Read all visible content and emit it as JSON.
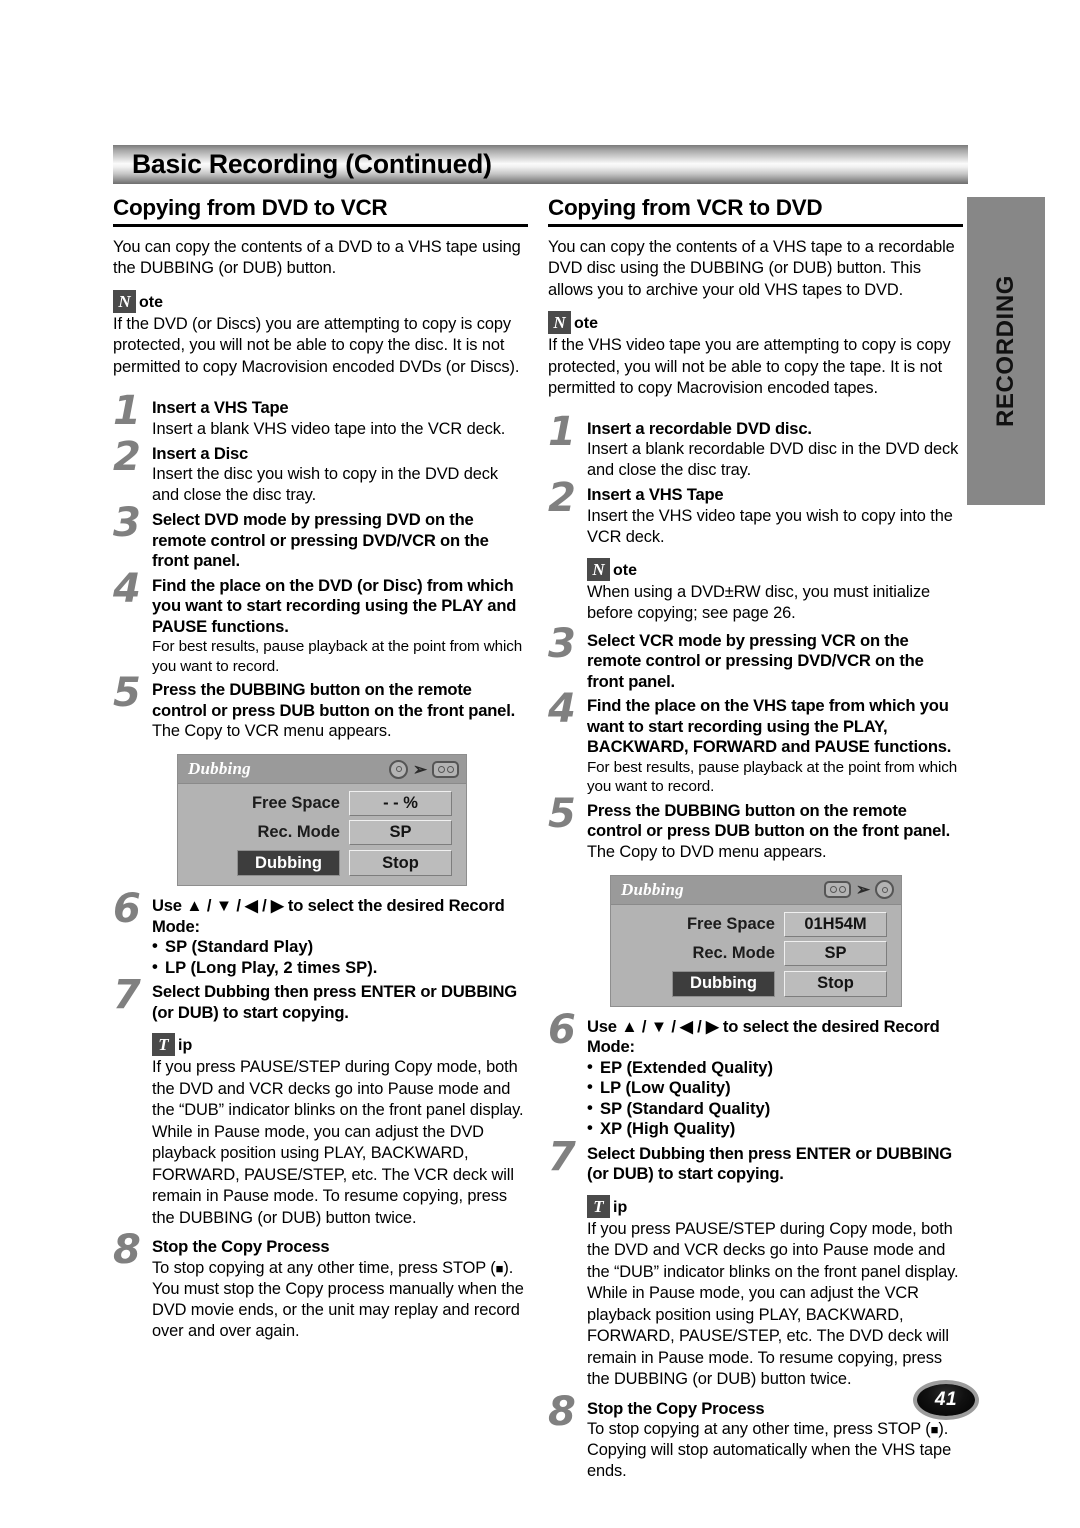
{
  "header": {
    "title": "Basic Recording (Continued)"
  },
  "side_tab": {
    "label": "RECORDING"
  },
  "page_number": "41",
  "left_column": {
    "section_title": "Copying from DVD to VCR",
    "intro": "You can copy the contents of a DVD to a VHS tape using the DUBBING (or DUB) button.",
    "note": {
      "glyph": "N",
      "tail": "ote",
      "text": "If the DVD (or Discs) you are attempting to copy is copy protected, you will not be able to copy the disc. It is not permitted to copy Macrovision encoded DVDs (or Discs)."
    },
    "steps": [
      {
        "num": "1",
        "head": "Insert a VHS Tape",
        "sub": "Insert a blank VHS video tape into the VCR deck."
      },
      {
        "num": "2",
        "head": "Insert a Disc",
        "sub": "Insert the disc you wish to copy in the DVD deck and close the disc tray."
      },
      {
        "num": "3",
        "head": "Select DVD mode by pressing DVD on the remote control or pressing DVD/VCR on the front panel."
      },
      {
        "num": "4",
        "head": "Find the place on the DVD (or Disc) from which you want to start recording using the PLAY and PAUSE functions.",
        "sub": "For best results, pause playback at the point from which you want to record."
      },
      {
        "num": "5",
        "head": "Press the DUBBING button on the remote control or press DUB button on the front panel.",
        "sub": "The Copy to VCR menu appears."
      },
      {
        "num": "6",
        "head": "Use ▲ / ▼ / ◀ / ▶ to select the desired Record Mode:",
        "bullets": [
          "SP (Standard Play)",
          "LP (Long Play, 2 times SP)."
        ]
      },
      {
        "num": "7",
        "head": "Select Dubbing then press ENTER or DUBBING (or DUB) to start copying."
      },
      {
        "num": "8",
        "head": "Stop the Copy Process",
        "sub_pre": "To stop copying at any other time, press STOP (",
        "sub_post": "). You must stop the Copy process manually when the DVD movie ends, or the unit may replay and record over and over again."
      }
    ],
    "osd": {
      "title": "Dubbing",
      "source_icon": "disc-icon",
      "arrow_icon": "arrow-right-icon",
      "target_icon": "cassette-icon",
      "free_space_label": "Free Space",
      "free_space_value": "- - %",
      "rec_mode_label": "Rec. Mode",
      "rec_mode_value": "SP",
      "dubbing_button": "Dubbing",
      "stop_button": "Stop"
    },
    "tip": {
      "glyph": "T",
      "tail": "ip",
      "text": "If you press PAUSE/STEP during Copy mode, both the DVD and VCR decks go into Pause mode and the “DUB” indicator blinks on the front panel display. While in Pause mode, you can adjust the DVD playback position using PLAY, BACKWARD, FORWARD, PAUSE/STEP, etc. The VCR deck will remain in Pause mode. To resume copying, press the DUBBING (or DUB) button twice."
    }
  },
  "right_column": {
    "section_title": "Copying from VCR to DVD",
    "intro": "You can copy the contents of a VHS tape to a recordable DVD disc using the DUBBING (or DUB) button. This allows you to archive your old VHS tapes to DVD.",
    "note": {
      "glyph": "N",
      "tail": "ote",
      "text": "If the VHS video tape you are attempting to copy is copy protected, you will not be able to copy the tape. It is not permitted to copy Macrovision encoded tapes."
    },
    "note2": {
      "glyph": "N",
      "tail": "ote",
      "text": "When using a DVD±RW disc, you must initialize before copying; see page 26."
    },
    "steps": [
      {
        "num": "1",
        "head": "Insert a recordable DVD disc.",
        "sub": "Insert a blank recordable DVD disc in the DVD deck and close the disc tray."
      },
      {
        "num": "2",
        "head": "Insert a VHS Tape",
        "sub": "Insert the VHS video tape you wish to copy into the VCR deck."
      },
      {
        "num": "3",
        "head": "Select VCR mode by pressing VCR on the remote control or pressing DVD/VCR on the front panel."
      },
      {
        "num": "4",
        "head": "Find the place on the VHS tape from which you want to start recording using the PLAY, BACKWARD, FORWARD and PAUSE functions.",
        "sub": "For best results, pause playback at the point from which you want to record."
      },
      {
        "num": "5",
        "head": "Press the DUBBING button on the remote control or press DUB button on the front panel.",
        "sub": "The Copy to DVD menu appears."
      },
      {
        "num": "6",
        "head": "Use ▲ / ▼ / ◀ / ▶ to select the desired Record Mode:",
        "bullets": [
          "EP (Extended Quality)",
          "LP (Low Quality)",
          "SP (Standard Quality)",
          "XP (High Quality)"
        ]
      },
      {
        "num": "7",
        "head": "Select Dubbing then press ENTER or DUBBING (or DUB) to start copying."
      },
      {
        "num": "8",
        "head": "Stop the Copy Process",
        "sub_pre": "To stop copying at any other time, press STOP (",
        "sub_post": "). Copying will stop automatically when the VHS tape ends."
      }
    ],
    "osd": {
      "title": "Dubbing",
      "source_icon": "cassette-icon",
      "arrow_icon": "arrow-right-icon",
      "target_icon": "disc-icon",
      "free_space_label": "Free Space",
      "free_space_value": "01H54M",
      "rec_mode_label": "Rec. Mode",
      "rec_mode_value": "SP",
      "dubbing_button": "Dubbing",
      "stop_button": "Stop"
    },
    "tip": {
      "glyph": "T",
      "tail": "ip",
      "text": "If you press PAUSE/STEP during Copy mode, both the DVD and VCR decks go into Pause mode and the “DUB” indicator blinks on the front panel display. While in Pause mode, you can adjust the VCR playback position using PLAY, BACKWARD, FORWARD, PAUSE/STEP, etc. The DVD deck will remain in Pause mode. To resume copying, press the DUBBING (or DUB) button twice."
    }
  }
}
